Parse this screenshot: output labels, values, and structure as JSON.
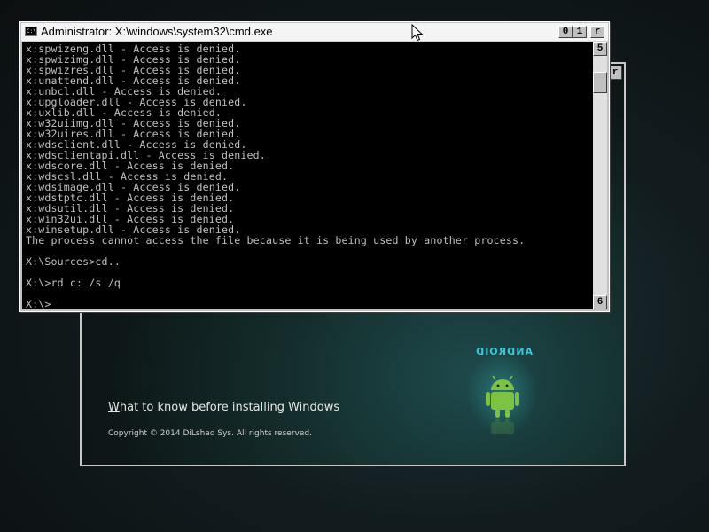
{
  "setup": {
    "close_label": "r",
    "what_to_know_first": "W",
    "what_to_know_rest": "hat to know before installing Windows",
    "copyright": "Copyright © 2014 DiLshad Sys. All rights reserved.",
    "android_text": "ANDROID",
    "android_color": "#7dc242"
  },
  "cmd": {
    "title": "Administrator: X:\\windows\\system32\\cmd.exe",
    "icon_label": "C:\\",
    "controls": {
      "minimize": "0",
      "maximize": "1",
      "close": "r"
    },
    "scroll_up": "5",
    "scroll_down": "6",
    "lines": [
      "x:spwizeng.dll - Access is denied.",
      "x:spwizimg.dll - Access is denied.",
      "x:spwizres.dll - Access is denied.",
      "x:unattend.dll - Access is denied.",
      "x:unbcl.dll - Access is denied.",
      "x:upgloader.dll - Access is denied.",
      "x:uxlib.dll - Access is denied.",
      "x:w32uiimg.dll - Access is denied.",
      "x:w32uires.dll - Access is denied.",
      "x:wdsclient.dll - Access is denied.",
      "x:wdsclientapi.dll - Access is denied.",
      "x:wdscore.dll - Access is denied.",
      "x:wdscsl.dll - Access is denied.",
      "x:wdsimage.dll - Access is denied.",
      "x:wdstptc.dll - Access is denied.",
      "x:wdsutil.dll - Access is denied.",
      "x:win32ui.dll - Access is denied.",
      "x:winsetup.dll - Access is denied.",
      "The process cannot access the file because it is being used by another process.",
      "",
      "X:\\Sources>cd..",
      "",
      "X:\\>rd c: /s /q",
      "",
      "X:\\>"
    ]
  }
}
